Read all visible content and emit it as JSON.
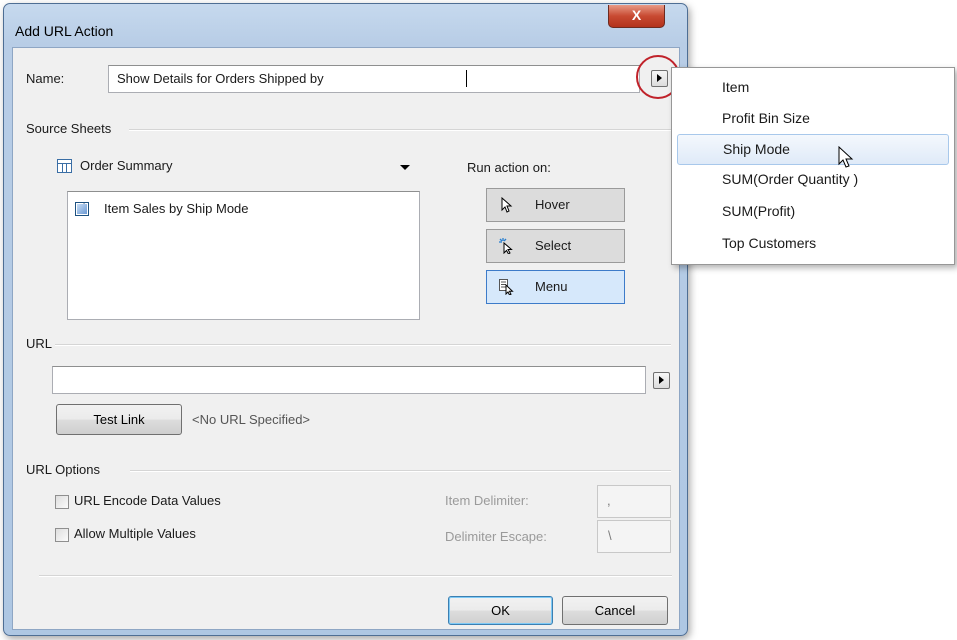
{
  "dialog": {
    "title": "Add URL Action",
    "close_symbol": "X"
  },
  "name": {
    "label": "Name:",
    "value": "Show Details for Orders Shipped by "
  },
  "source_sheets": {
    "group_label": "Source Sheets",
    "selected_source": "Order Summary",
    "sheets": [
      {
        "label": "Item Sales by Ship Mode",
        "checked": true
      }
    ]
  },
  "run_action": {
    "label": "Run action on:",
    "buttons": [
      {
        "label": "Hover",
        "icon": "pointer-icon"
      },
      {
        "label": "Select",
        "icon": "select-click-icon"
      },
      {
        "label": "Menu",
        "icon": "menu-pointer-icon",
        "active": true
      }
    ]
  },
  "url": {
    "group_label": "URL",
    "value": "",
    "test_link_label": "Test Link",
    "status": "<No URL Specified>"
  },
  "url_options": {
    "group_label": "URL Options",
    "encode_label": "URL Encode Data Values",
    "allow_multiple_label": "Allow Multiple Values",
    "item_delimiter_label": "Item Delimiter:",
    "item_delimiter_value": ",",
    "delimiter_escape_label": "Delimiter Escape:",
    "delimiter_escape_value": "\\"
  },
  "footer": {
    "ok_label": "OK",
    "cancel_label": "Cancel"
  },
  "field_menu": {
    "items": [
      {
        "label": "Item"
      },
      {
        "label": "Profit Bin Size"
      },
      {
        "label": "Ship Mode",
        "highlighted": true
      },
      {
        "label": "SUM(Order Quantity )"
      },
      {
        "label": "SUM(Profit)"
      },
      {
        "label": "Top Customers"
      }
    ]
  },
  "colors": {
    "highlight_circle": "#c0222a",
    "active_button": "#d6e8fb",
    "window_frame": "#aec7e3"
  }
}
